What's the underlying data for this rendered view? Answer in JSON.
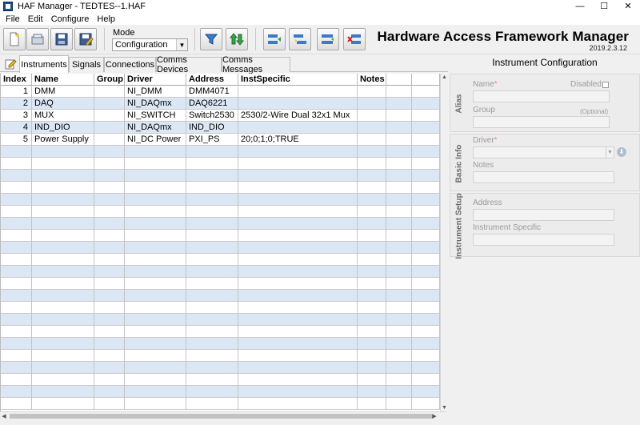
{
  "window": {
    "title": "HAF Manager - TEDTES--1.HAF",
    "minimize": "—",
    "maximize": "☐",
    "close": "✕"
  },
  "menu": [
    "File",
    "Edit",
    "Configure",
    "Help"
  ],
  "toolbar": {
    "mode_label": "Mode",
    "mode_value": "Configuration",
    "app_title": "Hardware Access Framework Manager",
    "version": "2019.2.3.12",
    "icons": [
      "new-file-icon",
      "open-file-icon",
      "save-icon",
      "save-as-icon",
      "filter-icon",
      "sort-icon",
      "move-in-icon",
      "move-out-icon",
      "insert-row-icon",
      "delete-row-icon"
    ]
  },
  "tabs": [
    "Instruments",
    "Signals",
    "Connections",
    "Comms Devices",
    "Comms Messages"
  ],
  "grid": {
    "columns": [
      "Index",
      "Name",
      "Group",
      "Driver",
      "Address",
      "InstSpecific",
      "Notes",
      "",
      ""
    ],
    "rows": [
      [
        "1",
        "DMM",
        "",
        "NI_DMM",
        "DMM4071",
        "",
        "",
        "",
        ""
      ],
      [
        "2",
        "DAQ",
        "",
        "NI_DAQmx",
        "DAQ6221",
        "",
        "",
        "",
        ""
      ],
      [
        "3",
        "MUX",
        "",
        "NI_SWITCH",
        "Switch2530",
        "2530/2-Wire Dual 32x1 Mux",
        "",
        "",
        ""
      ],
      [
        "4",
        "IND_DIO",
        "",
        "NI_DAQmx",
        "IND_DIO",
        "",
        "",
        "",
        ""
      ],
      [
        "5",
        "Power Supply",
        "",
        "NI_DC Power",
        "PXI_PS",
        "20;0;1;0;TRUE",
        "",
        "",
        ""
      ]
    ]
  },
  "panel": {
    "title": "Instrument Configuration",
    "alias": {
      "section_label": "Alias",
      "name_label": "Name",
      "required_mark": "*",
      "disabled_label": "Disabled",
      "group_label": "Group",
      "optional_label": "(Optional)"
    },
    "basic": {
      "section_label": "Basic Info",
      "driver_label": "Driver",
      "required_mark": "*",
      "notes_label": "Notes"
    },
    "setup": {
      "section_label": "Instrument Setup",
      "address_label": "Address",
      "specific_label": "Instrument Specific"
    }
  },
  "colors": {
    "row_alt": "#dbe7f5",
    "accent": "#1c4e8a"
  }
}
